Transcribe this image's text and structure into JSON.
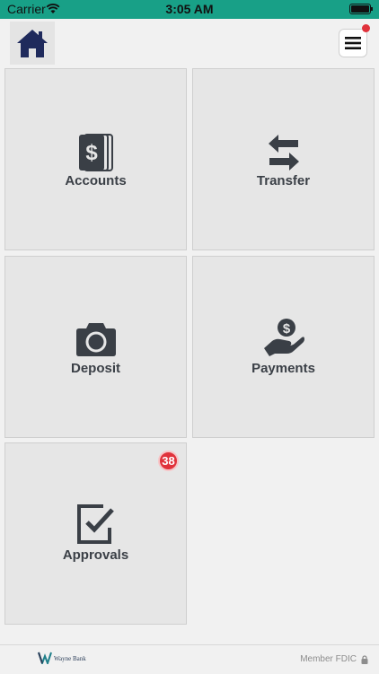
{
  "status_bar": {
    "carrier": "Carrier",
    "time": "3:05 AM"
  },
  "navbar": {
    "home_icon": "home-icon",
    "menu_icon": "hamburger-menu-icon",
    "has_notification": true
  },
  "tiles": [
    {
      "label": "Accounts",
      "icon": "dollar-cards-icon"
    },
    {
      "label": "Transfer",
      "icon": "transfer-arrows-icon"
    },
    {
      "label": "Deposit",
      "icon": "camera-icon"
    },
    {
      "label": "Payments",
      "icon": "hand-coin-icon"
    },
    {
      "label": "Approvals",
      "icon": "checkbox-icon",
      "badge": "38"
    }
  ],
  "footer": {
    "brand": "Wayne Bank",
    "fdic": "Member FDIC"
  },
  "colors": {
    "status_bar": "#18a087",
    "icon": "#3a3f46",
    "home_icon": "#1f2a5c",
    "badge": "#e0323b"
  }
}
